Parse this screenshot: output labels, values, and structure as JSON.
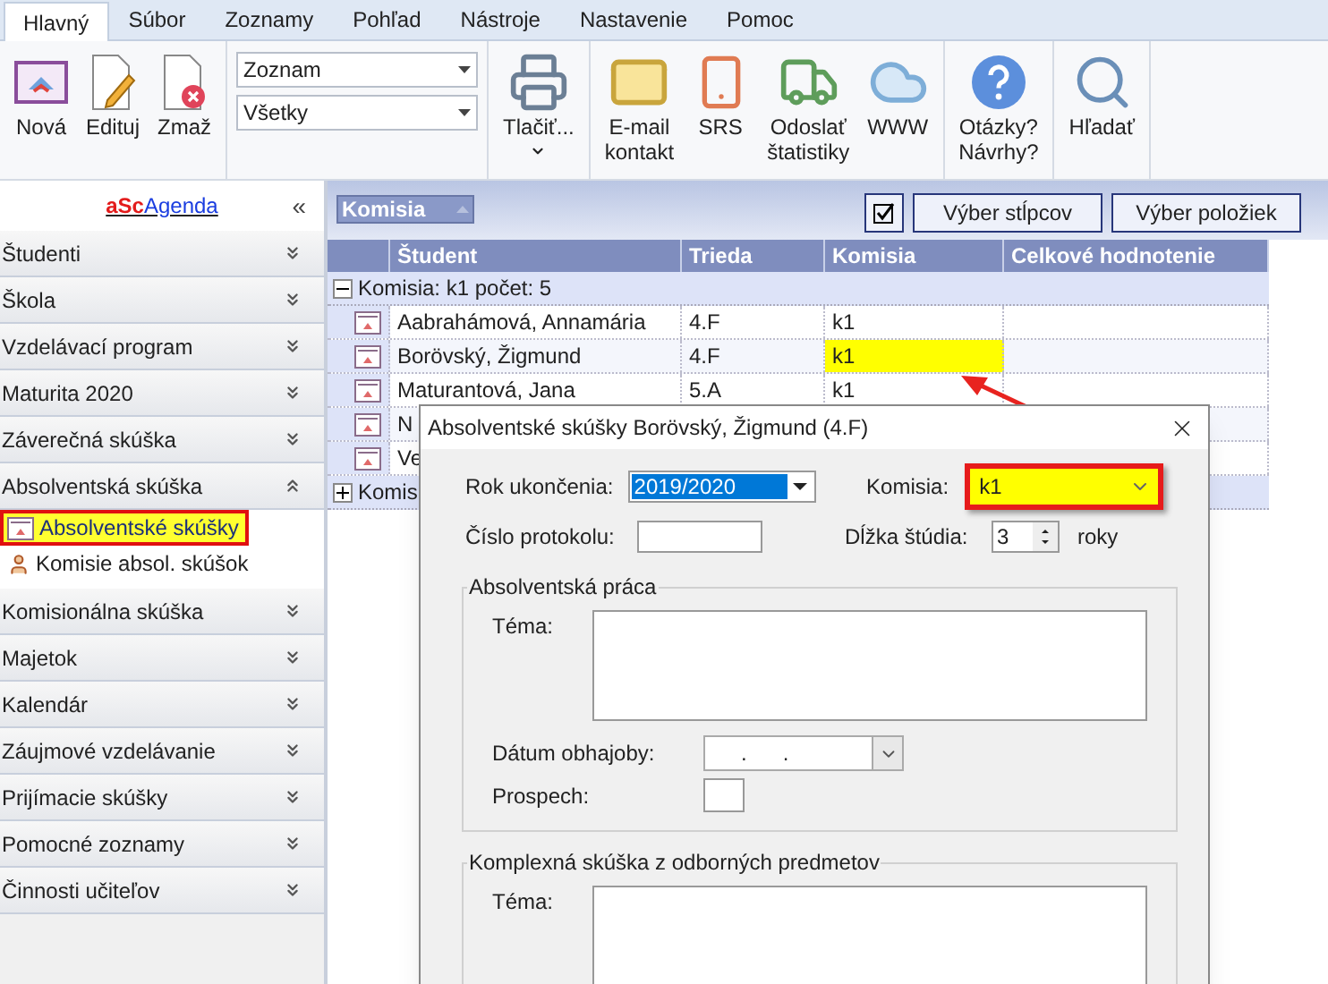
{
  "ribbon": {
    "tabs": [
      {
        "label": "Hlavný",
        "selected": true
      },
      {
        "label": "Súbor",
        "selected": false
      },
      {
        "label": "Zoznamy",
        "selected": false
      },
      {
        "label": "Pohľad",
        "selected": false
      },
      {
        "label": "Nástroje",
        "selected": false
      },
      {
        "label": "Nastavenie",
        "selected": false
      },
      {
        "label": "Pomoc",
        "selected": false
      }
    ],
    "groups": [
      {
        "kind": "buttons",
        "items": [
          {
            "label": "Nová"
          },
          {
            "label": "Edituj"
          },
          {
            "label": "Zmaž"
          }
        ]
      },
      {
        "kind": "selects",
        "items": [
          {
            "value": "Zoznam"
          },
          {
            "value": "Všetky"
          }
        ]
      },
      {
        "kind": "buttons",
        "items": [
          {
            "label": "Tlačiť...",
            "dropdown": true
          }
        ]
      },
      {
        "kind": "buttons",
        "items": [
          {
            "label": "E-mail\nkontakt"
          },
          {
            "label": "SRS"
          },
          {
            "label": "Odoslať\nštatistiky"
          },
          {
            "label": "WWW"
          }
        ]
      },
      {
        "kind": "buttons",
        "items": [
          {
            "label": "Otázky?\nNávrhy?"
          }
        ]
      },
      {
        "kind": "buttons",
        "items": [
          {
            "label": "Hľadať"
          }
        ]
      }
    ]
  },
  "sidebar": {
    "logo_red": "aSc",
    "logo_blue": "Agenda",
    "collapse": "«",
    "items": [
      {
        "label": "Študenti",
        "expanded": false
      },
      {
        "label": "Škola",
        "expanded": false
      },
      {
        "label": "Vzdelávací program",
        "expanded": false
      },
      {
        "label": "Maturita 2020",
        "expanded": false
      },
      {
        "label": "Záverečná skúška",
        "expanded": false
      },
      {
        "label": "Absolventská skúška",
        "expanded": true,
        "children": [
          {
            "label": "Absolventské skúšky",
            "selected": true
          },
          {
            "label": "Komisie absol. skúšok",
            "selected": false
          }
        ]
      },
      {
        "label": "Komisionálna skúška",
        "expanded": false
      },
      {
        "label": "Majetok",
        "expanded": false
      },
      {
        "label": "Kalendár",
        "expanded": false
      },
      {
        "label": "Záujmové vzdelávanie",
        "expanded": false
      },
      {
        "label": "Prijímacie skúšky",
        "expanded": false
      },
      {
        "label": "Pomocné zoznamy",
        "expanded": false
      },
      {
        "label": "Činnosti učiteľov",
        "expanded": false
      }
    ]
  },
  "grid": {
    "group_by": "Komisia",
    "column_chooser_checked": true,
    "buttons": [
      "Výber stĺpcov",
      "Výber položiek"
    ],
    "columns": [
      "Študent",
      "Trieda",
      "Komisia",
      "Celkové hodnotenie"
    ],
    "groups": [
      {
        "label": "Komisia: k1 počet: 5",
        "expanded": true,
        "rows": [
          {
            "cells": [
              "Aabrahámová, Annamária",
              "4.F",
              "k1",
              ""
            ],
            "highlighted": false
          },
          {
            "cells": [
              "Borövský, Žigmund",
              "4.F",
              "k1",
              ""
            ],
            "highlighted": true
          },
          {
            "cells": [
              "Maturantová, Jana",
              "5.A",
              "k1",
              ""
            ],
            "highlighted": false
          },
          {
            "cells": [
              "N"
            ]
          },
          {
            "cells": [
              "Ve"
            ]
          }
        ]
      },
      {
        "label": "Komis",
        "expanded": false
      }
    ]
  },
  "dialog": {
    "title": "Absolventské skúšky Borövský, Žigmund (4.F)",
    "year_label": "Rok ukončenia:",
    "year_value": "2019/2020",
    "commission_label": "Komisia:",
    "commission_value": "k1",
    "commission_highlighted": true,
    "protocol_label": "Číslo protokolu:",
    "length_label": "Dĺžka štúdia:",
    "length_value": "3",
    "length_unit": "roky",
    "sections": [
      {
        "title": "Absolventská práca",
        "kind": "thesis",
        "topic_label": "Téma:",
        "date_label": "Dátum obhajoby:",
        "date_value": ".      .",
        "grade_label": "Prospech:"
      },
      {
        "title": "Komplexná skúška z odborných predmetov",
        "kind": "exam",
        "topic_label": "Téma:"
      }
    ]
  }
}
